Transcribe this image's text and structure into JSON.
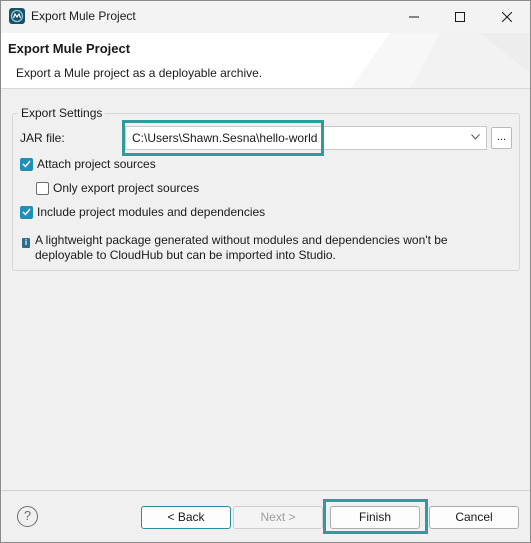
{
  "window": {
    "title": "Export Mule Project"
  },
  "header": {
    "title": "Export Mule Project",
    "description": "Export a Mule project as a deployable archive."
  },
  "settings": {
    "legend": "Export Settings",
    "jar_label": "JAR file:",
    "jar_value": "C:\\Users\\Shawn.Sesna\\hello-world",
    "browse_label": "...",
    "options": [
      {
        "label": "Attach project sources",
        "checked": true
      },
      {
        "label": "Only export project sources",
        "checked": false
      },
      {
        "label": "Include project modules and dependencies",
        "checked": true
      }
    ],
    "info_icon": "i",
    "info_text": "A lightweight package generated without modules and dependencies won't be deployable to CloudHub but can be imported into Studio."
  },
  "footer": {
    "help_glyph": "?",
    "back_label": "< Back",
    "next_label": "Next >",
    "finish_label": "Finish",
    "cancel_label": "Cancel"
  },
  "colors": {
    "highlight": "#2f9b9a",
    "checkbox_on": "#1f8fb8",
    "app_icon": "#1d4f63"
  },
  "icons": {
    "app": "mule-app-icon",
    "minimize": "minimize-icon",
    "maximize": "maximize-icon",
    "close": "close-icon",
    "info": "info-icon",
    "help": "help-icon",
    "dropdown": "chevron-down-icon"
  }
}
